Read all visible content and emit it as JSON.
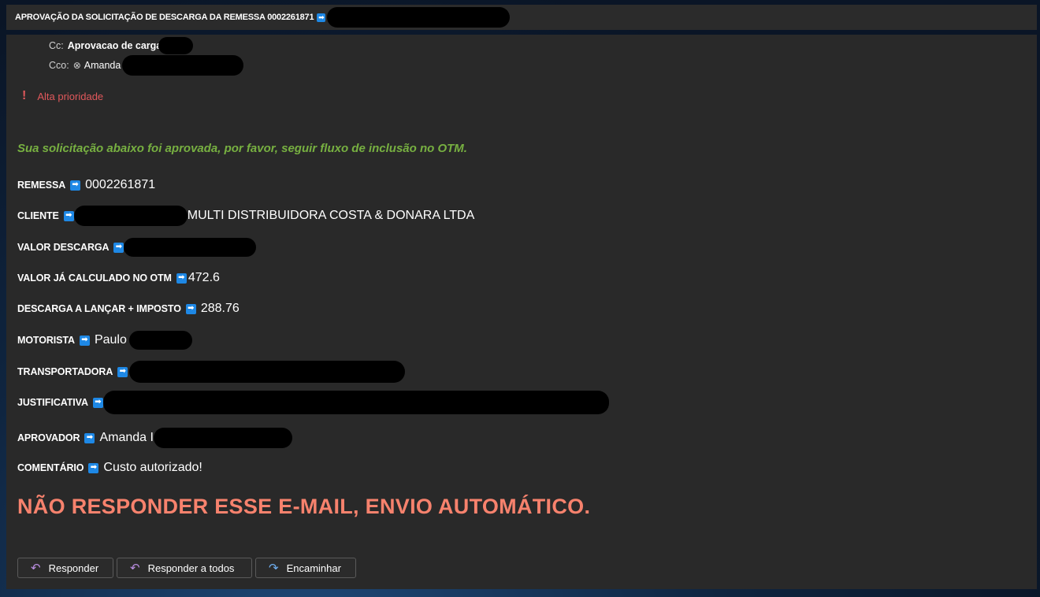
{
  "window": {
    "title": "APROVAÇÃO DA SOLICITAÇÃO DE DESCARGA DA REMESSA 0002261871",
    "title_arrow": "➡"
  },
  "header": {
    "cc_label": "Cc:",
    "cc_value": "Aprovacao de carga",
    "cco_label": "Cco:",
    "cco_value": "Amanda"
  },
  "priority": {
    "icon": "exclamation-icon",
    "symbol": "!",
    "label": "Alta prioridade"
  },
  "body": {
    "approved_message": "Sua solicitação abaixo foi aprovada, por favor, seguir fluxo de inclusão no OTM.",
    "arrow": "➡",
    "fields": {
      "remessa": {
        "label": "REMESSA",
        "value": "0002261871"
      },
      "cliente": {
        "label": "CLIENTE",
        "value": "MULTI DISTRIBUIDORA COSTA & DONARA LTDA"
      },
      "valor_descarga": {
        "label": "VALOR DESCARGA",
        "value": ""
      },
      "valor_otm": {
        "label": "VALOR JÁ CALCULADO NO OTM",
        "value": "472.6"
      },
      "descarga_lancar": {
        "label": "DESCARGA A LANÇAR + IMPOSTO",
        "value": "288.76"
      },
      "motorista": {
        "label": "MOTORISTA",
        "value": "Paulo"
      },
      "transportadora": {
        "label": "TRANSPORTADORA",
        "value": ""
      },
      "justificativa": {
        "label": "JUSTIFICATIVA",
        "value": ""
      },
      "aprovador": {
        "label": "APROVADOR",
        "value": "Amanda I"
      },
      "comentario": {
        "label": "COMENTÁRIO",
        "value": "Custo autorizado!"
      }
    },
    "warning": "NÃO RESPONDER ESSE E-MAIL, ENVIO AUTOMÁTICO."
  },
  "actions": {
    "reply": {
      "label": "Responder",
      "icon": "reply-icon"
    },
    "reply_all": {
      "label": "Responder a todos",
      "icon": "reply-all-icon"
    },
    "forward": {
      "label": "Encaminhar",
      "icon": "forward-icon"
    }
  },
  "colors": {
    "approved_text": "#77b041",
    "priority_text": "#e0585b",
    "warning_text": "#f7826d",
    "arrow_badge": "#1e88e5"
  }
}
